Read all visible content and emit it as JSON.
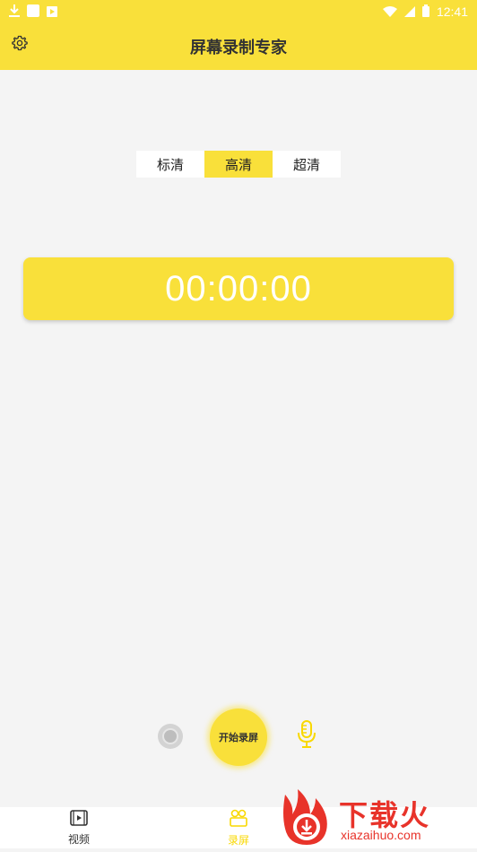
{
  "status_bar": {
    "time": "12:41",
    "left_icons": [
      "download-icon",
      "square-app-icon",
      "play-app-icon"
    ],
    "right_icons": [
      "wifi-icon",
      "signal-icon",
      "battery-icon"
    ],
    "color": "#f9e03a"
  },
  "app_bar": {
    "title": "屏幕录制专家",
    "settings_icon": "gear-icon"
  },
  "quality": {
    "options": [
      "标清",
      "高清",
      "超清"
    ],
    "selected": "高清"
  },
  "timer": {
    "value": "00:00:00"
  },
  "controls": {
    "record_label": "开始录屏",
    "camera_icon": "camera-toggle-icon",
    "mic_icon": "microphone-icon"
  },
  "bottom_nav": {
    "items": [
      {
        "label": "视频",
        "icon": "video-file-icon",
        "active": false
      },
      {
        "label": "录屏",
        "icon": "video-camera-icon",
        "active": true
      }
    ]
  },
  "watermark": {
    "title": "下载火",
    "url": "xiazaihuo.com"
  },
  "colors": {
    "accent": "#f9e03a",
    "background": "#f4f4f4",
    "watermark": "#e8332a"
  }
}
